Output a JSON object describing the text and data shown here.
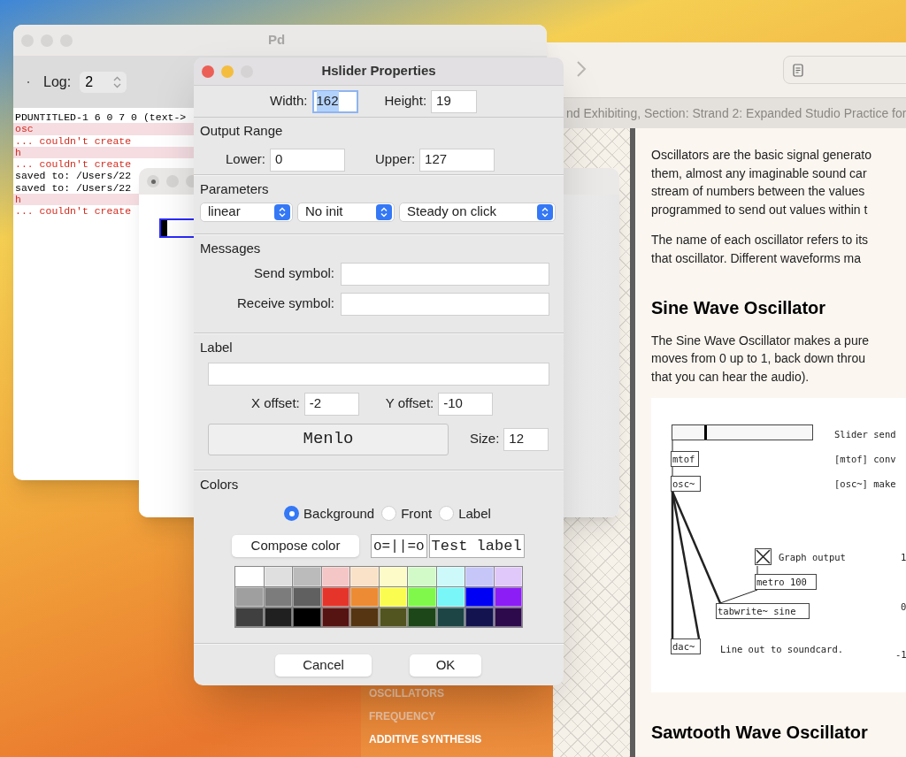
{
  "pd_window": {
    "title": "Pd",
    "log_label": "Log:",
    "log_value": "2",
    "console": [
      {
        "text": "PDUNTITLED-1 6 0 7 0 (text->",
        "kind": "info",
        "highlighted": false
      },
      {
        "text": "osc",
        "kind": "error",
        "highlighted": true
      },
      {
        "text": "... couldn't create",
        "kind": "error",
        "highlighted": false
      },
      {
        "text": "h",
        "kind": "error",
        "highlighted": true
      },
      {
        "text": "... couldn't create",
        "kind": "error",
        "highlighted": false
      },
      {
        "text": "saved to: /Users/22",
        "kind": "info",
        "highlighted": false
      },
      {
        "text": "saved to: /Users/22",
        "kind": "info",
        "highlighted": false
      },
      {
        "text": "h",
        "kind": "error",
        "highlighted": true
      },
      {
        "text": "... couldn't create",
        "kind": "error",
        "highlighted": false
      }
    ]
  },
  "patch_window": {
    "slider": {
      "level": 0
    }
  },
  "browser": {
    "tab_title": "nd Exhibiting, Section: Strand 2: Expanded Studio Practice for",
    "menu": [
      {
        "label": "OSCILLATORS",
        "visited": true
      },
      {
        "label": "FREQUENCY",
        "visited": true
      },
      {
        "label": "ADDITIVE SYNTHESIS",
        "visited": false
      }
    ],
    "article": [
      {
        "kind": "paragraph",
        "lines": [
          "Oscillators are the basic signal generato",
          "them, almost any imaginable sound car",
          "stream of numbers between the values",
          "programmed to send out values within t"
        ]
      },
      {
        "kind": "paragraph",
        "lines": [
          "The name of each oscillator refers to its",
          "that oscillator. Different waveforms ma"
        ]
      },
      {
        "kind": "heading",
        "lines": [
          "Sine Wave Oscillator"
        ]
      },
      {
        "kind": "paragraph",
        "lines": [
          "The Sine Wave Oscillator makes a pure",
          "moves from 0 up to 1, back down throu",
          "that you can hear the audio)."
        ]
      },
      {
        "kind": "diagram"
      },
      {
        "kind": "heading",
        "lines": [
          "Sawtooth Wave Oscillator"
        ]
      }
    ],
    "diagram": {
      "slider": {
        "level": 0.23
      },
      "toggle": {
        "checked": true
      },
      "objects": [
        "mtof",
        "osc~",
        "metro 100",
        "tabwrite~ sine",
        "dac~"
      ],
      "comments": [
        "Slider send",
        "[mtof] conv",
        "[osc~] make",
        "Graph output",
        "Line out to soundcard."
      ],
      "graph_labels": [
        "1",
        "0",
        "-1"
      ]
    }
  },
  "dialog": {
    "title": "Hslider Properties",
    "width_label": "Width:",
    "width_value": "162",
    "width_text_selected": true,
    "height_label": "Height:",
    "height_value": "19",
    "output_range": {
      "title": "Output Range",
      "lower_label": "Lower:",
      "lower_value": "0",
      "upper_label": "Upper:",
      "upper_value": "127"
    },
    "parameters": {
      "title": "Parameters",
      "dropdowns": [
        "linear",
        "No init",
        "Steady on click"
      ]
    },
    "messages": {
      "title": "Messages",
      "send_label": "Send symbol:",
      "receive_label": "Receive symbol:"
    },
    "label": {
      "title": "Label",
      "x_offset_label": "X offset:",
      "x_offset_value": "-2",
      "y_offset_label": "Y offset:",
      "y_offset_value": "-10",
      "font": "Menlo",
      "size_label": "Size:",
      "size_value": "12"
    },
    "colors": {
      "title": "Colors",
      "targets": [
        {
          "label": "Background",
          "selected": true
        },
        {
          "label": "Front",
          "selected": false
        },
        {
          "label": "Label",
          "selected": false
        }
      ],
      "compose_button": "Compose color",
      "preview_slider": "o=||=o",
      "preview_label": "Test label",
      "swatches": [
        {
          "color": "#ffffff"
        },
        {
          "color": "#dfdfdf"
        },
        {
          "color": "#bbbbbb"
        },
        {
          "color": "#f5c6c6"
        },
        {
          "color": "#f9e2c8"
        },
        {
          "color": "#fdfcc8"
        },
        {
          "color": "#d2fac8"
        },
        {
          "color": "#cdf9fb"
        },
        {
          "color": "#c7c6f8"
        },
        {
          "color": "#e0c8fa"
        },
        {
          "color": "#9f9f9f"
        },
        {
          "color": "#7c7c7c"
        },
        {
          "color": "#606060"
        },
        {
          "color": "#e5352b"
        },
        {
          "color": "#ec8b33"
        },
        {
          "color": "#fbfc50"
        },
        {
          "color": "#7ff84b"
        },
        {
          "color": "#79f6f7"
        },
        {
          "color": "#0000f5"
        },
        {
          "color": "#8c1df5"
        },
        {
          "color": "#404040"
        },
        {
          "color": "#202020"
        },
        {
          "color": "#000000"
        },
        {
          "color": "#551312"
        },
        {
          "color": "#553512"
        },
        {
          "color": "#525520"
        },
        {
          "color": "#1d4718"
        },
        {
          "color": "#1d4545"
        },
        {
          "color": "#13134f"
        },
        {
          "color": "#2d0a4b"
        }
      ]
    },
    "buttons": [
      "Cancel",
      "OK"
    ]
  }
}
